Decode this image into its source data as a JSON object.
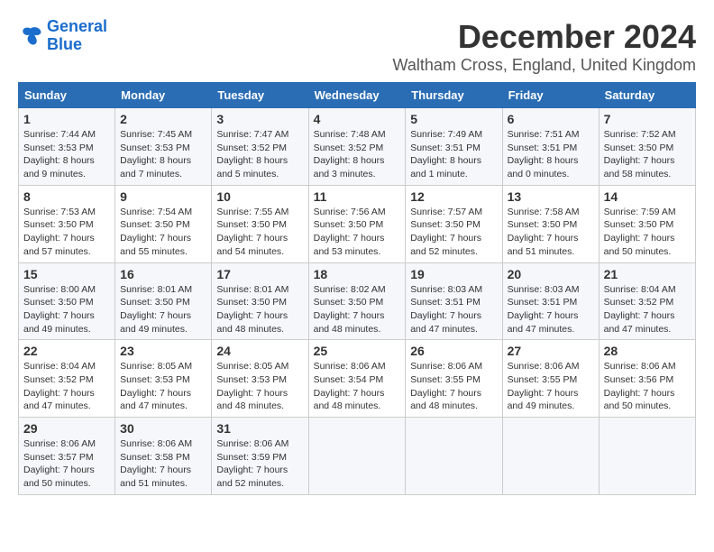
{
  "header": {
    "logo_line1": "General",
    "logo_line2": "Blue",
    "month_title": "December 2024",
    "subtitle": "Waltham Cross, England, United Kingdom"
  },
  "weekdays": [
    "Sunday",
    "Monday",
    "Tuesday",
    "Wednesday",
    "Thursday",
    "Friday",
    "Saturday"
  ],
  "weeks": [
    [
      {
        "day": "1",
        "sunrise": "7:44 AM",
        "sunset": "3:53 PM",
        "daylight": "8 hours and 9 minutes."
      },
      {
        "day": "2",
        "sunrise": "7:45 AM",
        "sunset": "3:53 PM",
        "daylight": "8 hours and 7 minutes."
      },
      {
        "day": "3",
        "sunrise": "7:47 AM",
        "sunset": "3:52 PM",
        "daylight": "8 hours and 5 minutes."
      },
      {
        "day": "4",
        "sunrise": "7:48 AM",
        "sunset": "3:52 PM",
        "daylight": "8 hours and 3 minutes."
      },
      {
        "day": "5",
        "sunrise": "7:49 AM",
        "sunset": "3:51 PM",
        "daylight": "8 hours and 1 minute."
      },
      {
        "day": "6",
        "sunrise": "7:51 AM",
        "sunset": "3:51 PM",
        "daylight": "8 hours and 0 minutes."
      },
      {
        "day": "7",
        "sunrise": "7:52 AM",
        "sunset": "3:50 PM",
        "daylight": "7 hours and 58 minutes."
      }
    ],
    [
      {
        "day": "8",
        "sunrise": "7:53 AM",
        "sunset": "3:50 PM",
        "daylight": "7 hours and 57 minutes."
      },
      {
        "day": "9",
        "sunrise": "7:54 AM",
        "sunset": "3:50 PM",
        "daylight": "7 hours and 55 minutes."
      },
      {
        "day": "10",
        "sunrise": "7:55 AM",
        "sunset": "3:50 PM",
        "daylight": "7 hours and 54 minutes."
      },
      {
        "day": "11",
        "sunrise": "7:56 AM",
        "sunset": "3:50 PM",
        "daylight": "7 hours and 53 minutes."
      },
      {
        "day": "12",
        "sunrise": "7:57 AM",
        "sunset": "3:50 PM",
        "daylight": "7 hours and 52 minutes."
      },
      {
        "day": "13",
        "sunrise": "7:58 AM",
        "sunset": "3:50 PM",
        "daylight": "7 hours and 51 minutes."
      },
      {
        "day": "14",
        "sunrise": "7:59 AM",
        "sunset": "3:50 PM",
        "daylight": "7 hours and 50 minutes."
      }
    ],
    [
      {
        "day": "15",
        "sunrise": "8:00 AM",
        "sunset": "3:50 PM",
        "daylight": "7 hours and 49 minutes."
      },
      {
        "day": "16",
        "sunrise": "8:01 AM",
        "sunset": "3:50 PM",
        "daylight": "7 hours and 49 minutes."
      },
      {
        "day": "17",
        "sunrise": "8:01 AM",
        "sunset": "3:50 PM",
        "daylight": "7 hours and 48 minutes."
      },
      {
        "day": "18",
        "sunrise": "8:02 AM",
        "sunset": "3:50 PM",
        "daylight": "7 hours and 48 minutes."
      },
      {
        "day": "19",
        "sunrise": "8:03 AM",
        "sunset": "3:51 PM",
        "daylight": "7 hours and 47 minutes."
      },
      {
        "day": "20",
        "sunrise": "8:03 AM",
        "sunset": "3:51 PM",
        "daylight": "7 hours and 47 minutes."
      },
      {
        "day": "21",
        "sunrise": "8:04 AM",
        "sunset": "3:52 PM",
        "daylight": "7 hours and 47 minutes."
      }
    ],
    [
      {
        "day": "22",
        "sunrise": "8:04 AM",
        "sunset": "3:52 PM",
        "daylight": "7 hours and 47 minutes."
      },
      {
        "day": "23",
        "sunrise": "8:05 AM",
        "sunset": "3:53 PM",
        "daylight": "7 hours and 47 minutes."
      },
      {
        "day": "24",
        "sunrise": "8:05 AM",
        "sunset": "3:53 PM",
        "daylight": "7 hours and 48 minutes."
      },
      {
        "day": "25",
        "sunrise": "8:06 AM",
        "sunset": "3:54 PM",
        "daylight": "7 hours and 48 minutes."
      },
      {
        "day": "26",
        "sunrise": "8:06 AM",
        "sunset": "3:55 PM",
        "daylight": "7 hours and 48 minutes."
      },
      {
        "day": "27",
        "sunrise": "8:06 AM",
        "sunset": "3:55 PM",
        "daylight": "7 hours and 49 minutes."
      },
      {
        "day": "28",
        "sunrise": "8:06 AM",
        "sunset": "3:56 PM",
        "daylight": "7 hours and 50 minutes."
      }
    ],
    [
      {
        "day": "29",
        "sunrise": "8:06 AM",
        "sunset": "3:57 PM",
        "daylight": "7 hours and 50 minutes."
      },
      {
        "day": "30",
        "sunrise": "8:06 AM",
        "sunset": "3:58 PM",
        "daylight": "7 hours and 51 minutes."
      },
      {
        "day": "31",
        "sunrise": "8:06 AM",
        "sunset": "3:59 PM",
        "daylight": "7 hours and 52 minutes."
      },
      null,
      null,
      null,
      null
    ]
  ]
}
